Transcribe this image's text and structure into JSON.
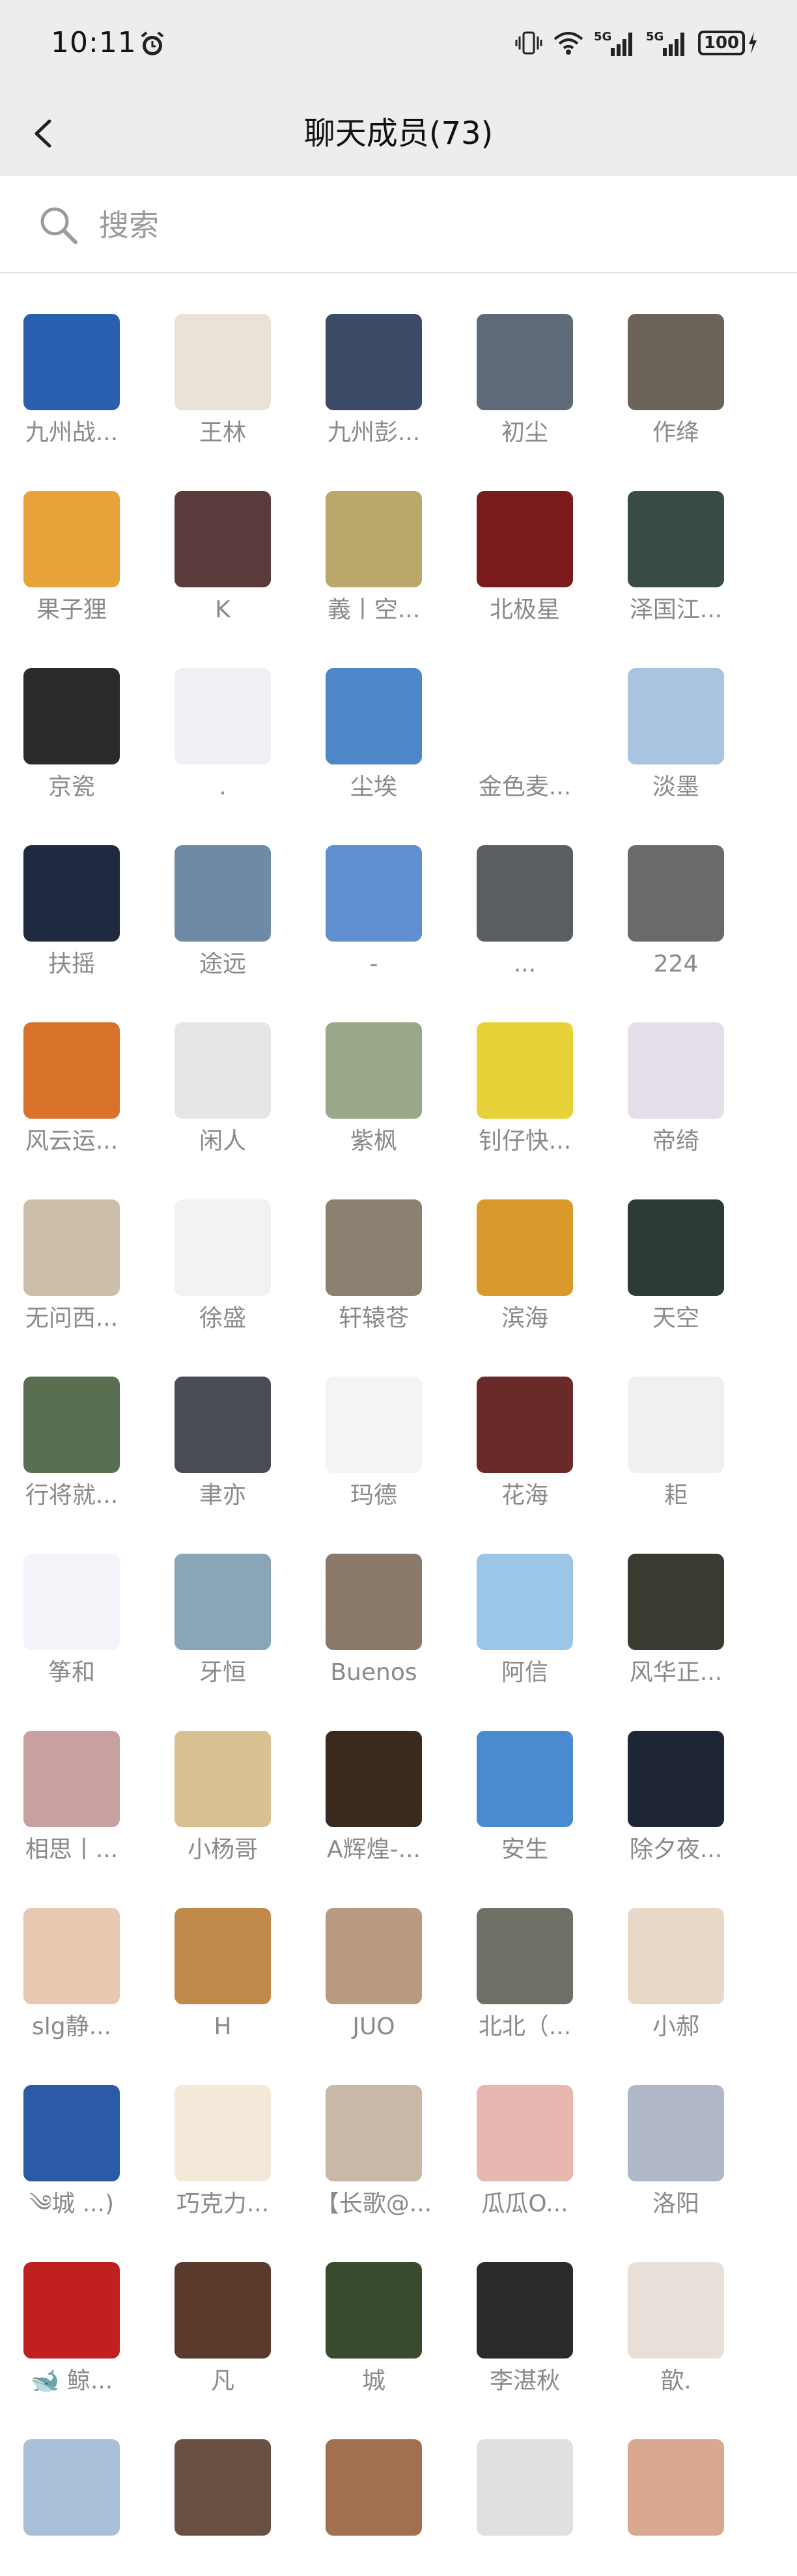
{
  "status_bar": {
    "time": "10:11",
    "network_1": "5G",
    "network_2": "5G",
    "battery": "100"
  },
  "header": {
    "title": "聊天成员(73)"
  },
  "search": {
    "placeholder": "搜索"
  },
  "colors": {
    "header_bg": "#ededed",
    "name_text": "#8a8a8a",
    "placeholder_text": "#9b9b9b"
  },
  "members": [
    {
      "name": "九州战...",
      "color": "#2a5fb0"
    },
    {
      "name": "王林",
      "color": "#e9e2d8"
    },
    {
      "name": "九州彭...",
      "color": "#3c4a66"
    },
    {
      "name": "初尘",
      "color": "#5e6a78"
    },
    {
      "name": "作绛",
      "color": "#6b6258"
    },
    {
      "name": "果子狸",
      "color": "#e8a23a"
    },
    {
      "name": "K",
      "color": "#5a3a3a"
    },
    {
      "name": "義丨空...",
      "color": "#b9a86a"
    },
    {
      "name": "北极星",
      "color": "#7a1a1a"
    },
    {
      "name": "泽国江...",
      "color": "#3a4a46"
    },
    {
      "name": "京瓷",
      "color": "#2b2b2b"
    },
    {
      "name": ".",
      "color": "#eef0f6"
    },
    {
      "name": "尘埃",
      "color": "#4d87c8"
    },
    {
      "name": "金色麦...",
      "color": "#ffffff"
    },
    {
      "name": "淡墨",
      "color": "#a8c4e0"
    },
    {
      "name": "扶摇",
      "color": "#1f2a40"
    },
    {
      "name": "途远",
      "color": "#6f8aa4"
    },
    {
      "name": "-",
      "color": "#5f8fd0"
    },
    {
      "name": "...",
      "color": "#5a5e60"
    },
    {
      "name": "224",
      "color": "#6a6a6a"
    },
    {
      "name": "风云运...",
      "color": "#d9732c"
    },
    {
      "name": "闲人",
      "color": "#e6e6e6"
    },
    {
      "name": "紫枫",
      "color": "#9aa88a"
    },
    {
      "name": "钊仔快...",
      "color": "#e8d23a"
    },
    {
      "name": "帝绮",
      "color": "#e4dfe8"
    },
    {
      "name": "无问西...",
      "color": "#cbbfa9"
    },
    {
      "name": "徐盛",
      "color": "#f2f2f2"
    },
    {
      "name": "轩辕苍",
      "color": "#8c8070"
    },
    {
      "name": "滨海",
      "color": "#d89a2a"
    },
    {
      "name": "天空",
      "color": "#2e3a34"
    },
    {
      "name": "行将就...",
      "color": "#5a6e52"
    },
    {
      "name": "聿亦",
      "color": "#4a4e54"
    },
    {
      "name": "玛德",
      "color": "#f4f4f4"
    },
    {
      "name": "花海",
      "color": "#6a2a2a"
    },
    {
      "name": "耟",
      "color": "#f0f0f0"
    },
    {
      "name": "筝和",
      "color": "#f4f4fb"
    },
    {
      "name": "牙恒",
      "color": "#8aa4b8"
    },
    {
      "name": "Buenos",
      "color": "#8a7868"
    },
    {
      "name": "阿信",
      "color": "#9cc6e8"
    },
    {
      "name": "风华正...",
      "color": "#3a3a30"
    },
    {
      "name": "相思丨...",
      "color": "#c8a0a0"
    },
    {
      "name": "小杨哥",
      "color": "#d8c090"
    },
    {
      "name": "A辉煌-...",
      "color": "#3a2a1e"
    },
    {
      "name": "安生",
      "color": "#4a8ad0"
    },
    {
      "name": "除夕夜...",
      "color": "#1e2636"
    },
    {
      "name": "slg静...",
      "color": "#e8c8b0"
    },
    {
      "name": "H",
      "color": "#c08a4a"
    },
    {
      "name": "JUO",
      "color": "#b89a80"
    },
    {
      "name": "北北（...",
      "color": "#6e7066"
    },
    {
      "name": "小郝",
      "color": "#e8d8c8"
    },
    {
      "name": "༄城 ...)",
      "color": "#2a5aa8"
    },
    {
      "name": "巧克力...",
      "color": "#f4e8d8"
    },
    {
      "name": "【长歌@...",
      "color": "#c8b8a8"
    },
    {
      "name": "瓜瓜O...",
      "color": "#e8b8b0"
    },
    {
      "name": "洛阳",
      "color": "#b0b8c8"
    },
    {
      "name": "🐋 鲸...",
      "color": "#c02020"
    },
    {
      "name": "凡",
      "color": "#5a3a2a"
    },
    {
      "name": "城",
      "color": "#3a4a2e"
    },
    {
      "name": "李湛秋",
      "color": "#2a2a2a"
    },
    {
      "name": "歆.",
      "color": "#e8e0d8"
    },
    {
      "name": "",
      "color": "#a8c0d8"
    },
    {
      "name": "",
      "color": "#6a5040"
    },
    {
      "name": "",
      "color": "#a07050"
    },
    {
      "name": "",
      "color": "#e0e0e0"
    },
    {
      "name": "",
      "color": "#d8a890"
    }
  ]
}
